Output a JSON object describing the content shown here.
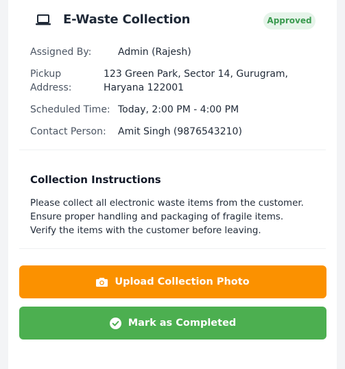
{
  "task": {
    "title": "E-Waste Collection",
    "status": "Approved",
    "icon": "laptop-icon"
  },
  "details": {
    "assigned_by_label": "Assigned By:",
    "assigned_by_value": "Admin (Rajesh)",
    "pickup_label_line1": "Pickup",
    "pickup_label_line2": "Address:",
    "pickup_value_line1": "123 Green Park, Sector 14, Gurugram,",
    "pickup_value_line2": "Haryana 122001",
    "scheduled_label": "Scheduled Time:",
    "scheduled_value": "Today, 2:00 PM - 4:00 PM",
    "contact_label": "Contact Person:",
    "contact_value": "Amit Singh (9876543210)"
  },
  "instructions": {
    "title": "Collection Instructions",
    "line1": "Please collect all electronic waste items from the customer.",
    "line2": "Ensure proper handling and packaging of fragile items.",
    "line3": "Verify the items with the customer before leaving."
  },
  "actions": {
    "upload_label": "Upload Collection Photo",
    "complete_label": "Mark as Completed"
  },
  "colors": {
    "upload_button": "#fb9100",
    "complete_button": "#4caf50",
    "badge_bg": "#e6f4ea",
    "badge_text": "#3a9a4f"
  }
}
